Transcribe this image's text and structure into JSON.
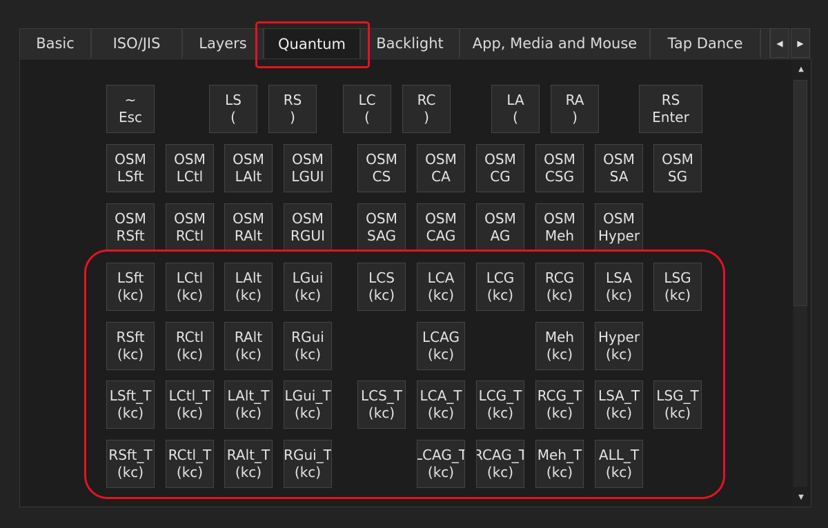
{
  "tabs": [
    {
      "label": "Basic",
      "active": false
    },
    {
      "label": "ISO/JIS",
      "active": false
    },
    {
      "label": "Layers",
      "active": false
    },
    {
      "label": "Quantum",
      "active": true
    },
    {
      "label": "Backlight",
      "active": false
    },
    {
      "label": "App, Media and Mouse",
      "active": false
    },
    {
      "label": "Tap Dance",
      "active": false
    }
  ],
  "tab_nav": {
    "prev_icon": "◀",
    "next_icon": "▶"
  },
  "scrollbar": {
    "up_icon": "▲",
    "down_icon": "▼"
  },
  "keys": {
    "row1": [
      {
        "id": "esc",
        "line1": "~",
        "line2": "Esc"
      },
      {
        "id": "ls-paren",
        "line1": "LS",
        "line2": "("
      },
      {
        "id": "rs-paren",
        "line1": "RS",
        "line2": ")"
      },
      {
        "id": "lc-paren",
        "line1": "LC",
        "line2": "("
      },
      {
        "id": "rc-paren",
        "line1": "RC",
        "line2": ")"
      },
      {
        "id": "la-paren",
        "line1": "LA",
        "line2": "("
      },
      {
        "id": "ra-paren",
        "line1": "RA",
        "line2": ")"
      },
      {
        "id": "rs-enter",
        "line1": "RS",
        "line2": "Enter"
      }
    ],
    "row2": [
      {
        "id": "osm-lsft",
        "line1": "OSM",
        "line2": "LSft"
      },
      {
        "id": "osm-lctl",
        "line1": "OSM",
        "line2": "LCtl"
      },
      {
        "id": "osm-lalt",
        "line1": "OSM",
        "line2": "LAlt"
      },
      {
        "id": "osm-lgui",
        "line1": "OSM",
        "line2": "LGUI"
      },
      {
        "id": "osm-cs",
        "line1": "OSM",
        "line2": "CS"
      },
      {
        "id": "osm-ca",
        "line1": "OSM",
        "line2": "CA"
      },
      {
        "id": "osm-cg",
        "line1": "OSM",
        "line2": "CG"
      },
      {
        "id": "osm-csg",
        "line1": "OSM",
        "line2": "CSG"
      },
      {
        "id": "osm-sa",
        "line1": "OSM",
        "line2": "SA"
      },
      {
        "id": "osm-sg",
        "line1": "OSM",
        "line2": "SG"
      }
    ],
    "row3": [
      {
        "id": "osm-rsft",
        "line1": "OSM",
        "line2": "RSft"
      },
      {
        "id": "osm-rctl",
        "line1": "OSM",
        "line2": "RCtl"
      },
      {
        "id": "osm-ralt",
        "line1": "OSM",
        "line2": "RAlt"
      },
      {
        "id": "osm-rgui",
        "line1": "OSM",
        "line2": "RGUI"
      },
      {
        "id": "osm-sag",
        "line1": "OSM",
        "line2": "SAG"
      },
      {
        "id": "osm-cag",
        "line1": "OSM",
        "line2": "CAG"
      },
      {
        "id": "osm-ag",
        "line1": "OSM",
        "line2": "AG"
      },
      {
        "id": "osm-meh",
        "line1": "OSM",
        "line2": "Meh"
      },
      {
        "id": "osm-hyper",
        "line1": "OSM",
        "line2": "Hyper"
      }
    ],
    "row4": [
      {
        "id": "lsft-kc",
        "line1": "LSft",
        "line2": "(kc)"
      },
      {
        "id": "lctl-kc",
        "line1": "LCtl",
        "line2": "(kc)"
      },
      {
        "id": "lalt-kc",
        "line1": "LAlt",
        "line2": "(kc)"
      },
      {
        "id": "lgui-kc",
        "line1": "LGui",
        "line2": "(kc)"
      },
      {
        "id": "lcs-kc",
        "line1": "LCS",
        "line2": "(kc)"
      },
      {
        "id": "lca-kc",
        "line1": "LCA",
        "line2": "(kc)"
      },
      {
        "id": "lcg-kc",
        "line1": "LCG",
        "line2": "(kc)"
      },
      {
        "id": "rcg-kc",
        "line1": "RCG",
        "line2": "(kc)"
      },
      {
        "id": "lsa-kc",
        "line1": "LSA",
        "line2": "(kc)"
      },
      {
        "id": "lsg-kc",
        "line1": "LSG",
        "line2": "(kc)"
      }
    ],
    "row5": [
      {
        "id": "rsft-kc",
        "line1": "RSft",
        "line2": "(kc)"
      },
      {
        "id": "rctl-kc",
        "line1": "RCtl",
        "line2": "(kc)"
      },
      {
        "id": "ralt-kc",
        "line1": "RAlt",
        "line2": "(kc)"
      },
      {
        "id": "rgui-kc",
        "line1": "RGui",
        "line2": "(kc)"
      },
      {
        "id": "lcag-kc",
        "line1": "LCAG",
        "line2": "(kc)"
      },
      {
        "id": "meh-kc",
        "line1": "Meh",
        "line2": "(kc)"
      },
      {
        "id": "hyper-kc",
        "line1": "Hyper",
        "line2": "(kc)"
      }
    ],
    "row6": [
      {
        "id": "lsft-t-kc",
        "line1": "LSft_T",
        "line2": "(kc)"
      },
      {
        "id": "lctl-t-kc",
        "line1": "LCtl_T",
        "line2": "(kc)"
      },
      {
        "id": "lalt-t-kc",
        "line1": "LAlt_T",
        "line2": "(kc)"
      },
      {
        "id": "lgui-t-kc",
        "line1": "LGui_T",
        "line2": "(kc)"
      },
      {
        "id": "lcs-t-kc",
        "line1": "LCS_T",
        "line2": "(kc)"
      },
      {
        "id": "lca-t-kc",
        "line1": "LCA_T",
        "line2": "(kc)"
      },
      {
        "id": "lcg-t-kc",
        "line1": "LCG_T",
        "line2": "(kc)"
      },
      {
        "id": "rcg-t-kc",
        "line1": "RCG_T",
        "line2": "(kc)"
      },
      {
        "id": "lsa-t-kc",
        "line1": "LSA_T",
        "line2": "(kc)"
      },
      {
        "id": "lsg-t-kc",
        "line1": "LSG_T",
        "line2": "(kc)"
      }
    ],
    "row7": [
      {
        "id": "rsft-t-kc",
        "line1": "RSft_T",
        "line2": "(kc)"
      },
      {
        "id": "rctl-t-kc",
        "line1": "RCtl_T",
        "line2": "(kc)"
      },
      {
        "id": "ralt-t-kc",
        "line1": "RAlt_T",
        "line2": "(kc)"
      },
      {
        "id": "rgui-t-kc",
        "line1": "RGui_T",
        "line2": "(kc)"
      },
      {
        "id": "lcag-t-kc",
        "line1": "LCAG_T",
        "line2": "(kc)"
      },
      {
        "id": "rcag-t-kc",
        "line1": "RCAG_T",
        "line2": "(kc)"
      },
      {
        "id": "meh-t-kc",
        "line1": "Meh_T",
        "line2": "(kc)"
      },
      {
        "id": "all-t-kc",
        "line1": "ALL_T",
        "line2": "(kc)"
      }
    ]
  },
  "colors": {
    "highlight": "#e81123"
  }
}
